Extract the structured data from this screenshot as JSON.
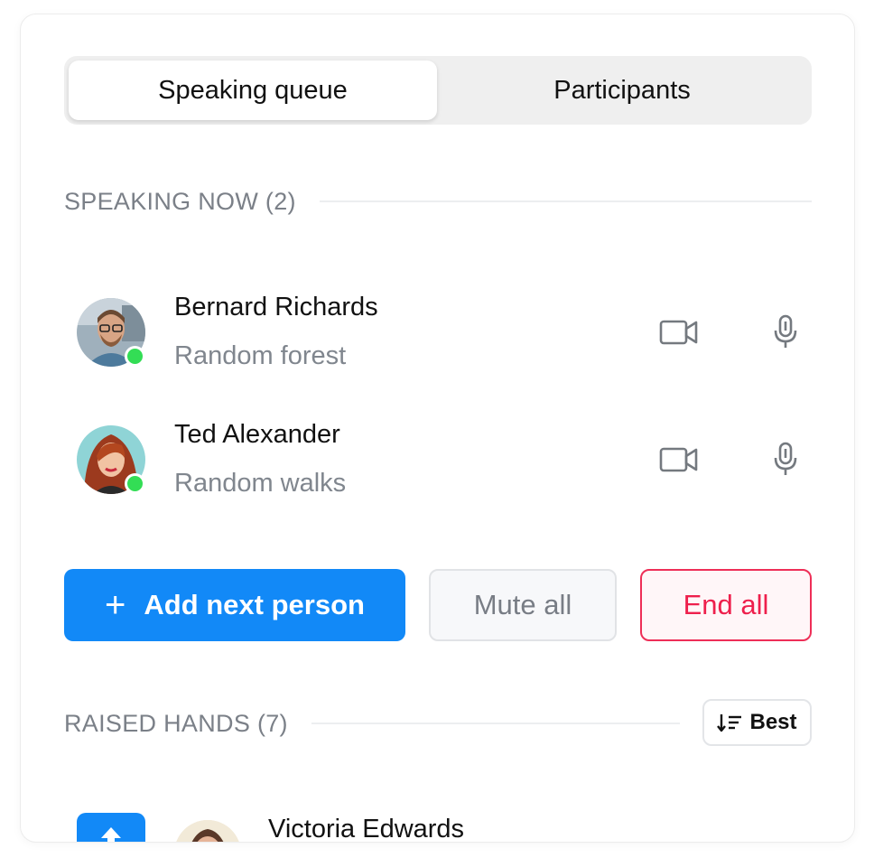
{
  "tabs": [
    {
      "label": "Speaking queue",
      "active": true
    },
    {
      "label": "Participants",
      "active": false
    }
  ],
  "speaking_now": {
    "title": "SPEAKING NOW (2)",
    "speakers": [
      {
        "name": "Bernard Richards",
        "topic": "Random forest",
        "online": true,
        "icons": [
          "video-camera-icon",
          "microphone-icon"
        ]
      },
      {
        "name": "Ted Alexander",
        "topic": "Random walks",
        "online": true,
        "icons": [
          "video-camera-icon",
          "microphone-icon"
        ]
      }
    ]
  },
  "actions": {
    "add_icon": "+",
    "add_label": "Add next person",
    "mute_label": "Mute all",
    "end_label": "End all"
  },
  "raised_hands": {
    "title": "RAISED HANDS (7)",
    "sort_label": "Best",
    "sort_icon": "sort-descending-icon",
    "items": [
      {
        "name": "Victoria Edwards"
      }
    ]
  },
  "colors": {
    "primary": "#1289f7",
    "danger": "#ee1f4c",
    "online": "#33dd55",
    "muted_text": "#80868e"
  }
}
